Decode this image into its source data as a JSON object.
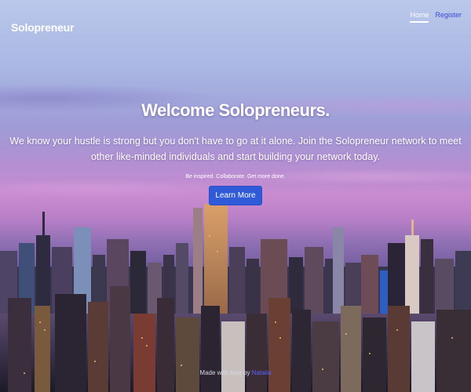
{
  "navbar": {
    "brand": "Solopreneur",
    "links": [
      {
        "label": "Home",
        "active": true
      },
      {
        "label": "Register",
        "active": false
      }
    ]
  },
  "hero": {
    "title": "Welcome Solopreneurs.",
    "text": "We know your hustle is strong but you don't have to go at it alone. Join the Solopreneur network to meet other like-minded individuals and start building your network today.",
    "tagline": "Be inspired. Collaborate. Get more done.",
    "cta_label": "Learn More"
  },
  "footer": {
    "prefix": "Made with love by",
    "author": "Natalia"
  },
  "colors": {
    "cta": "#2f5bd9",
    "register_link": "#3949d6",
    "author_link": "#5a64ff"
  },
  "background": {
    "description_icon": "city-skyline-image"
  }
}
